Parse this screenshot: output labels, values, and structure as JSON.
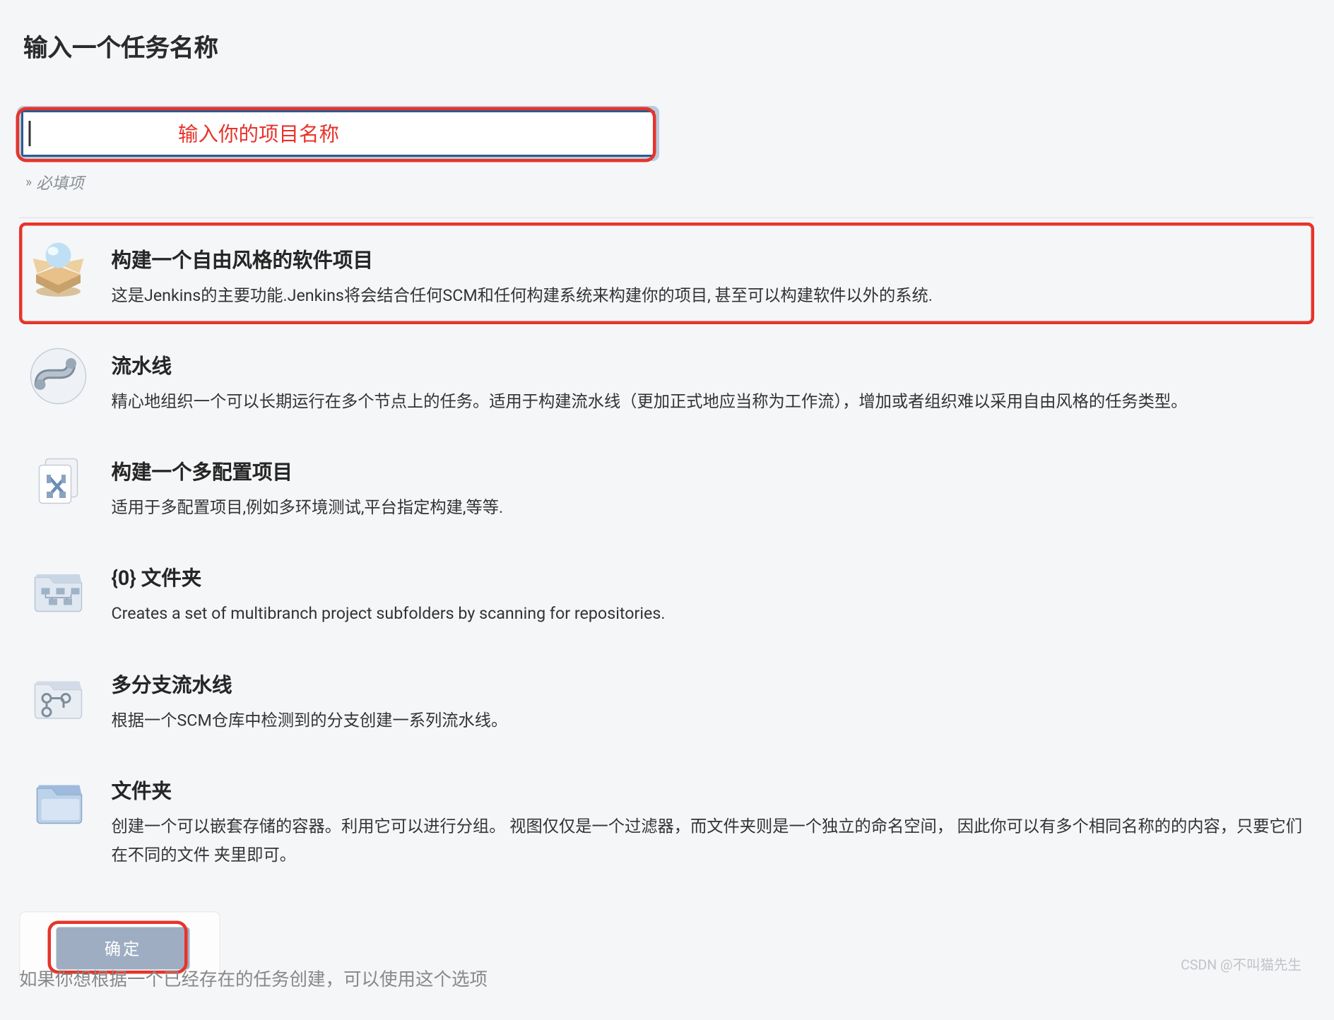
{
  "page": {
    "title": "输入一个任务名称"
  },
  "input": {
    "value": "",
    "annotation": "输入你的项目名称",
    "required_hint": "必填项"
  },
  "options": [
    {
      "icon": "freestyle-project-icon",
      "title": "构建一个自由风格的软件项目",
      "desc": "这是Jenkins的主要功能.Jenkins将会结合任何SCM和任何构建系统来构建你的项目, 甚至可以构建软件以外的系统."
    },
    {
      "icon": "pipeline-icon",
      "title": "流水线",
      "desc": "精心地组织一个可以长期运行在多个节点上的任务。适用于构建流水线（更加正式地应当称为工作流），增加或者组织难以采用自由风格的任务类型。"
    },
    {
      "icon": "multiconfig-icon",
      "title": "构建一个多配置项目",
      "desc": "适用于多配置项目,例如多环境测试,平台指定构建,等等."
    },
    {
      "icon": "org-folder-icon",
      "title": "{0} 文件夹",
      "desc": "Creates a set of multibranch project subfolders by scanning for repositories."
    },
    {
      "icon": "multibranch-icon",
      "title": "多分支流水线",
      "desc": "根据一个SCM仓库中检测到的分支创建一系列流水线。"
    },
    {
      "icon": "folder-icon",
      "title": "文件夹",
      "desc": "创建一个可以嵌套存储的容器。利用它可以进行分组。 视图仅仅是一个过滤器，而文件夹则是一个独立的命名空间， 因此你可以有多个相同名称的的内容，只要它们在不同的文件 夹里即可。"
    }
  ],
  "footer": {
    "ok_label": "确定",
    "copy_from_hint": "如果你想根据一个已经存在的任务创建，可以使用这个选项"
  },
  "watermark": "CSDN @不叫猫先生"
}
